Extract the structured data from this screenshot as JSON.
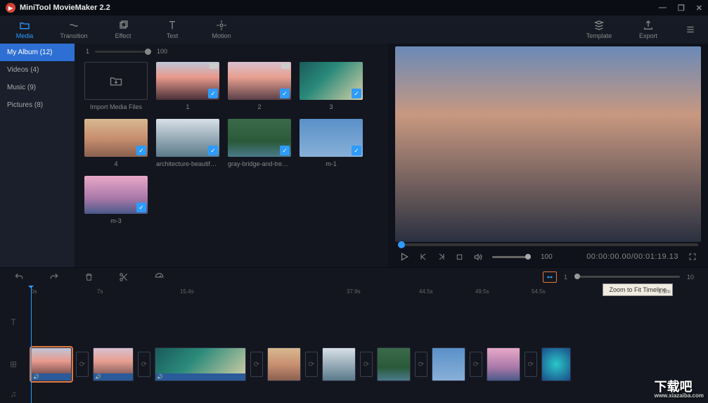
{
  "app": {
    "title": "MiniTool MovieMaker 2.2"
  },
  "tabs": {
    "media": "Media",
    "transition": "Transition",
    "effect": "Effect",
    "text": "Text",
    "motion": "Motion",
    "template": "Template",
    "export": "Export"
  },
  "sidebar": {
    "items": [
      {
        "label": "My Album",
        "count": "(12)"
      },
      {
        "label": "Videos",
        "count": "(4)"
      },
      {
        "label": "Music",
        "count": "(9)"
      },
      {
        "label": "Pictures",
        "count": "(8)"
      }
    ]
  },
  "media": {
    "zoom_min": "1",
    "zoom_max": "100",
    "import_label": "Import Media Files",
    "items": [
      {
        "label": "1"
      },
      {
        "label": "2"
      },
      {
        "label": "3"
      },
      {
        "label": "4"
      },
      {
        "label": "architecture-beautiful..."
      },
      {
        "label": "gray-bridge-and-trees..."
      },
      {
        "label": "m-1"
      },
      {
        "label": "m-3"
      }
    ]
  },
  "player": {
    "volume": "100",
    "time_current": "00:00:00.00",
    "time_total": "00:01:19.13"
  },
  "editbar": {
    "zoom_min": "1",
    "zoom_max": "10",
    "tooltip": "Zoom to Fit Timeline"
  },
  "ruler": [
    "0s",
    "7s",
    "15.4s",
    "37.9s",
    "44.5s",
    "49.5s",
    "54.5s",
    "1.1m"
  ],
  "watermark": {
    "text": "下载吧",
    "url": "www.xiazaiba.com"
  }
}
